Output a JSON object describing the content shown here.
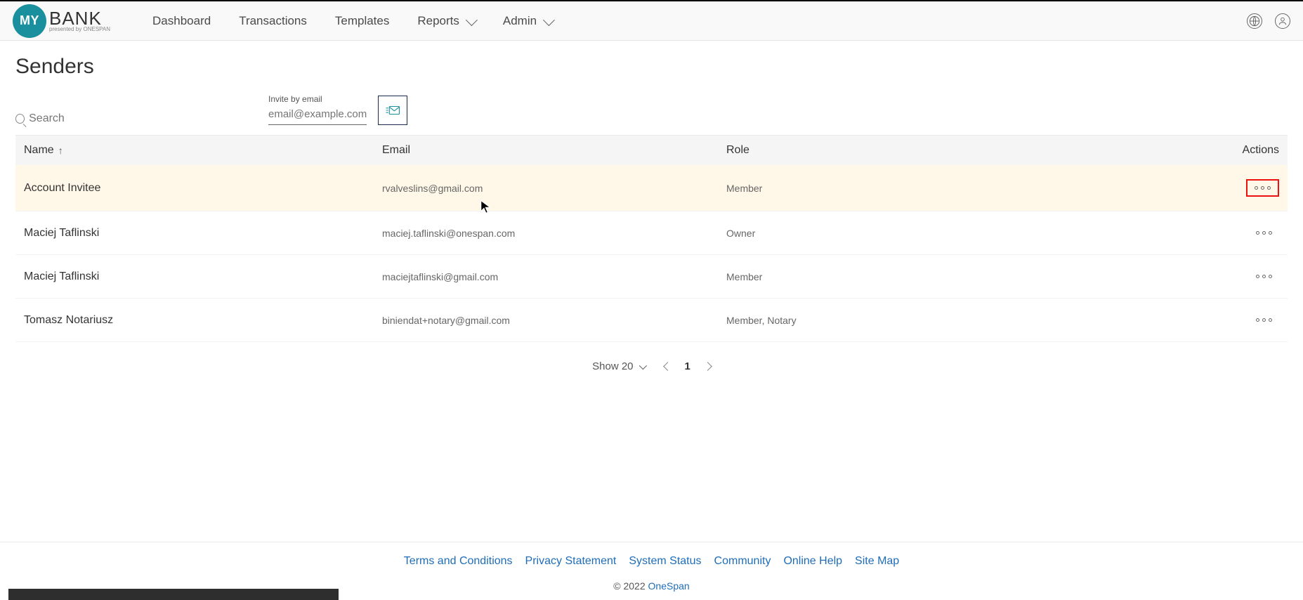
{
  "brand": {
    "badge": "MY",
    "name": "BANK",
    "sub": "presented by ONESPAN"
  },
  "nav": [
    {
      "label": "Dashboard",
      "dropdown": false
    },
    {
      "label": "Transactions",
      "dropdown": false
    },
    {
      "label": "Templates",
      "dropdown": false
    },
    {
      "label": "Reports",
      "dropdown": true
    },
    {
      "label": "Admin",
      "dropdown": true
    }
  ],
  "page": {
    "title": "Senders"
  },
  "search": {
    "placeholder": "Search"
  },
  "invite": {
    "label": "Invite by email",
    "placeholder": "email@example.com"
  },
  "table": {
    "headers": {
      "name": "Name",
      "email": "Email",
      "role": "Role",
      "actions": "Actions"
    },
    "rows": [
      {
        "name": "Account Invitee",
        "email": "rvalveslins@gmail.com",
        "role": "Member",
        "highlight": true,
        "actionsOutlined": true
      },
      {
        "name": "Maciej Taflinski",
        "email": "maciej.taflinski@onespan.com",
        "role": "Owner",
        "highlight": false,
        "actionsOutlined": false
      },
      {
        "name": "Maciej Taflinski",
        "email": "maciejtaflinski@gmail.com",
        "role": "Member",
        "highlight": false,
        "actionsOutlined": false
      },
      {
        "name": "Tomasz Notariusz",
        "email": "biniendat+notary@gmail.com",
        "role": "Member, Notary",
        "highlight": false,
        "actionsOutlined": false
      }
    ]
  },
  "pagination": {
    "showLabel": "Show 20",
    "current": "1"
  },
  "footer": {
    "links": [
      "Terms and Conditions",
      "Privacy Statement",
      "System Status",
      "Community",
      "Online Help",
      "Site Map"
    ],
    "copy_prefix": "© 2022 ",
    "copy_brand": "OneSpan"
  }
}
